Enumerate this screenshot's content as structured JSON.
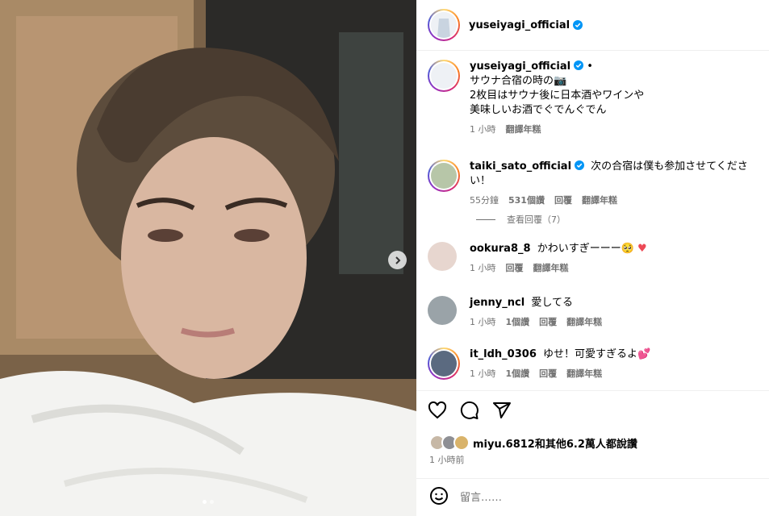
{
  "post": {
    "author": "yuseiyagi_official",
    "caption": "サウナ合宿の時の📷\n2枚目はサウナ後に日本酒やワインや\n美味しいお酒でぐでんぐでん",
    "caption_time": "1 小時",
    "see_translation": "翻譯年糕"
  },
  "comments": [
    {
      "user": "taiki_sato_official",
      "verified": true,
      "text": "次の合宿は僕も参加させてください！",
      "time": "55分鐘",
      "likes": "531個讚",
      "reply": "回覆",
      "translate": "翻譯年糕"
    },
    {
      "user": "ookura8_8",
      "verified": false,
      "text": "かわいすぎーーー🥺",
      "heart": "♥",
      "time": "1 小時",
      "reply": "回覆",
      "translate": "翻譯年糕"
    },
    {
      "user": "jenny_ncl",
      "verified": false,
      "text": "愛してる",
      "time": "1 小時",
      "likes": "1個讚",
      "reply": "回覆",
      "translate": "翻譯年糕"
    },
    {
      "user": "it_ldh_0306",
      "verified": false,
      "text": "ゆせ！可愛すぎるよ💕",
      "time": "1 小時",
      "likes": "1個讚",
      "reply": "回覆",
      "translate": "翻譯年糕"
    }
  ],
  "view_replies": "查看回覆（7）",
  "likes_summary": "miyu.6812和其他6.2萬人都說讚",
  "post_time": "1 小時前",
  "comment_placeholder": "留言……",
  "icons": {
    "like": "heart-icon",
    "comment": "comment-icon",
    "share": "share-icon",
    "emoji": "emoji-icon",
    "next": "chevron-right-icon",
    "verified": "verified-badge-icon"
  },
  "colors": {
    "verified": "#0095f6",
    "muted": "#737373",
    "heart": "#ed4956"
  }
}
